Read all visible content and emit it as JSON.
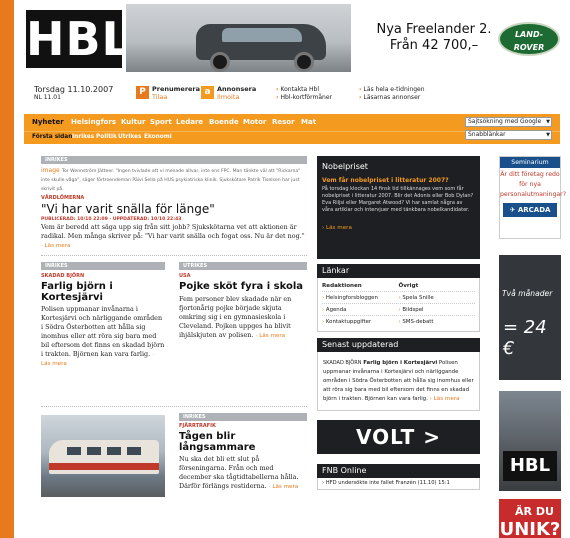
{
  "header": {
    "logo_text": "HBL",
    "ad_line1": "Nya Freelander 2.",
    "ad_line2": "Från 42 700,–",
    "ad_brand": "LAND-ROVER"
  },
  "infobar": {
    "date": "Torsdag 11.10.2007",
    "issue": "NL 11.01",
    "prenumerera": "Prenumerera",
    "tilaa": "Tilaa",
    "annonsera": "Annonsera",
    "ilmoita": "Ilmoita",
    "kontakta": "Kontakta Hbl",
    "kortformaner": "Hbl-kortförmåner",
    "e_tidningen": "Läs hela e-tidningen",
    "annonser": "Läsarnas annonser"
  },
  "nav": {
    "items": [
      "Nyheter",
      "Helsingfors",
      "Kultur",
      "Sport",
      "Ledare",
      "Boende",
      "Motor",
      "Resor",
      "Mat"
    ],
    "sub_items": [
      "Första sidan",
      "Inrikes",
      "Politik",
      "Utrikes",
      "Ekonomi"
    ],
    "search_select": "Sajtsökning med Google",
    "search_input": "Snabblänkar"
  },
  "main_story": {
    "section": "INRIKES",
    "image_label": "image",
    "caption": "Tor Wennström Jätteer. \"Ingen tvivlade att vi menade allvar, inte ens FPC. Man tänkte väl att \"Rickarna\" inte skulle våga\", säger förtroendeman Päivi Sella på HUS psykiatriska klinik. Sjukskötare Patrik Tiselsen har just skrivit på.",
    "kicker": "VÅRDLÖMERNA",
    "headline": "\"Vi har varit snälla för länge\"",
    "published": "PUBLICERAD: 10/10 22:09 · UPPDATERAD: 10/10 22:43",
    "body": "Vem är beredd att säga upp sig från sitt jobb? Sjukskötarna vet att aktionen är radikal. Men många skriver på: \"Vi har varit snälla och fogat oss. Nu är det nog.\"",
    "more": "Läs mera"
  },
  "story_bjorn": {
    "section": "INRIKES",
    "kicker": "SKADAD BJÖRN",
    "headline": "Farlig björn i Kortesjärvi",
    "body": "Polisen uppmanar invånarna i Kortesjärvi och närliggande områden i Södra Österbotten att hålla sig inomhus eller att röra sig bara med bil eftersom det finns en skadad björn i trakten. Björnen kan vara farlig.",
    "more": "Läs mera"
  },
  "story_usa": {
    "section": "UTRIKES",
    "kicker": "USA",
    "headline": "Pojke sköt fyra i skola",
    "body": "Fem personer blev skadade när en fjortonårig pojke började skjuta omkring sig i en gymnasieskola i Cleveland. Pojken uppges ha blivit ihjälskjuten av polisen.",
    "more": "Läs mera"
  },
  "story_tagen": {
    "section": "INRIKES",
    "kicker": "FJÄRRTRAFIK",
    "headline": "Tågen blir långsammare",
    "body": "Nu ska det bli ett slut på förseningarna. Från och med december ska tågtidtabellerna hålla. Därför förlängs restiderna.",
    "more": "Läs mera"
  },
  "nobel": {
    "title": "Nobelpriset",
    "question": "Vem får nobelpriset i litteratur 2007?",
    "desc": "På torsdag klockan 14 finsk tid tillkännages vem som får nobelpriset i litteratur 2007. Blir det Adonis eller Bob Dylan? Eva Riljsi eller Margaret Atwood? Vi har samlat några av våra artiklar och intervjuer med tänkbara nobelkandidater.",
    "more": "Läs mera"
  },
  "lankar": {
    "title": "Länkar",
    "headers": [
      "Redaktionen",
      "Övrigt"
    ],
    "rows": [
      [
        "Helsingforsbloggen",
        "Spela Snille"
      ],
      [
        "Agenda",
        "Bildspel"
      ],
      [
        "Kontaktuppgifter",
        "SMS-debatt"
      ]
    ]
  },
  "senast": {
    "title": "Senast uppdaterad",
    "kicker": "SKADAD BJÖRN",
    "headline": "Farlig björn i Kortesjärvi",
    "body": "Polisen uppmanar invånarna i Kortesjärvi och närliggande områden i Södra Österbotten att hålla sig inomhus eller att röra sig bara med bil eftersom det finns en skadad björn i trakten. Björnen kan vara farlig.",
    "more": "Läs mera"
  },
  "volt": {
    "text": "VOLT >"
  },
  "fnb": {
    "title": "FNB Online",
    "item": "HFD undersökte inte fallet Franzén (11.10) 15:1"
  },
  "right_ads": {
    "sem_title": "Seminarium",
    "sem_text": "Är ditt företag redo för nya personalutmaningar?",
    "arcada": "ARCADA",
    "dark_a": "Två månader",
    "dark_b": "= 24 €",
    "photo_logo": "HBL",
    "unik_1": "ÄR DU",
    "unik_2": "UNIK?"
  }
}
